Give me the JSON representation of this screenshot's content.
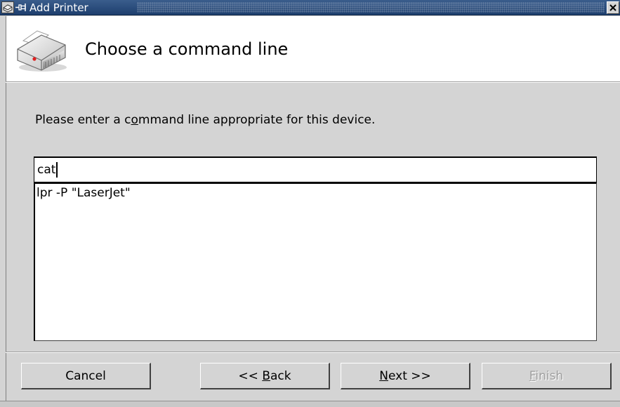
{
  "window": {
    "title": "Add Printer",
    "colors": {
      "titlebar": "#2a4d7e",
      "background": "#d4d4d4",
      "header_bg": "#ffffff"
    },
    "icons": [
      "printer-app-icon",
      "pin-icon",
      "close-icon"
    ]
  },
  "header": {
    "title": "Choose a command line",
    "icon": "printer-icon"
  },
  "prompt": {
    "before": "Please enter a c",
    "mnemonic": "o",
    "after": "mmand line appropriate for this device."
  },
  "command_input": {
    "value": "cat"
  },
  "suggestions": {
    "items": [
      "lpr -P \"LaserJet\""
    ]
  },
  "buttons": {
    "cancel": {
      "label": "Cancel"
    },
    "back": {
      "before": "<< ",
      "mnemonic": "B",
      "after": "ack"
    },
    "next": {
      "before": "",
      "mnemonic": "N",
      "after": "ext >>"
    },
    "finish": {
      "before": "",
      "mnemonic": "F",
      "after": "inish",
      "disabled": true
    }
  }
}
